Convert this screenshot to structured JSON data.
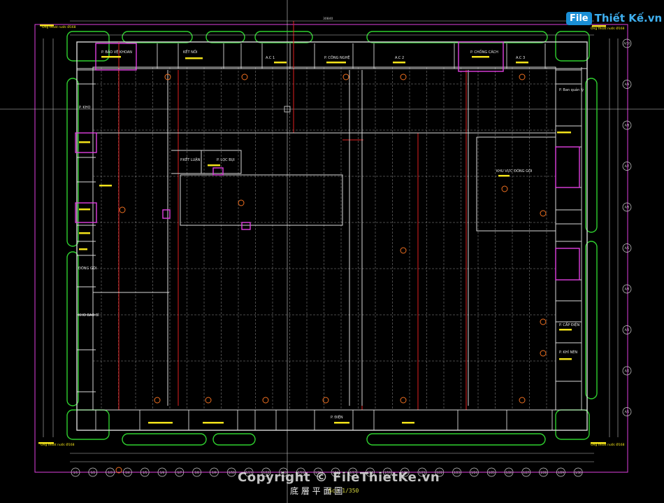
{
  "drawing": {
    "logo_box_text": "File",
    "logo_rest_text": "Thiết Kế.vn",
    "copyright": "Copyright © FileThietKe.vn",
    "title_cn": "底 層 平 面 圖",
    "scale": "Sc: 1/350",
    "overall_dim": "30840",
    "corner_note_tl": "Ông thoát nước Ø168",
    "corner_note_tr": "Ông thoát nước Ø168",
    "corner_note_bl": "Ông thoát nước Ø168",
    "corner_note_br": "Ông thoát nước Ø168",
    "colors": {
      "background": "#000000",
      "wall": "#d9d9d9",
      "grid": "#b8b8b8",
      "green": "#2fd12f",
      "red": "#e02020",
      "magenta": "#e040e0",
      "yellow": "#f2e21a",
      "orange": "#f07020",
      "crosshair": "#d0d0d0"
    },
    "rooms": [
      {
        "label": "P. BẢO VỆ KHOAN"
      },
      {
        "label": "KẾT NỐI"
      },
      {
        "label": "P. CÔNG NGHỆ"
      },
      {
        "label": "A.C 1"
      },
      {
        "label": "A.C 2"
      },
      {
        "label": "P. CHỐNG CÁCH"
      },
      {
        "label": "A.C 3"
      },
      {
        "label": "P. ĐIỆN"
      },
      {
        "label": "KHU VỰC ĐÓNG GÓI"
      },
      {
        "label": "P.KẾT LUẬN"
      },
      {
        "label": "P. LỌC BỤI"
      },
      {
        "label": "P. Ban quản lý"
      },
      {
        "label": "P. KHO"
      },
      {
        "label": "ĐÓNG GÓI"
      },
      {
        "label": "KHO BAO BÌ"
      },
      {
        "label": "P. CẤP ĐIỆN"
      },
      {
        "label": "P. KHÍ NÉN"
      }
    ],
    "bottom_axis_labels": [
      "1/1",
      "1/2",
      "1/3",
      "1/4",
      "1/5",
      "1/6",
      "1/7",
      "1/8",
      "1/9",
      "1/10",
      "1/11",
      "1/12",
      "1/13",
      "1/14",
      "1/15",
      "1/16",
      "1/17",
      "1/18",
      "1/19",
      "1/20",
      "1/21",
      "1/22",
      "1/23",
      "1/24",
      "1/25",
      "1/26",
      "1/27",
      "1/28",
      "1/29",
      "1/30"
    ],
    "right_axis_labels": [
      "A/10",
      "A/9",
      "A/8",
      "A/7",
      "A/6",
      "A/5",
      "A/4",
      "A/3",
      "A/2",
      "A/1"
    ]
  }
}
